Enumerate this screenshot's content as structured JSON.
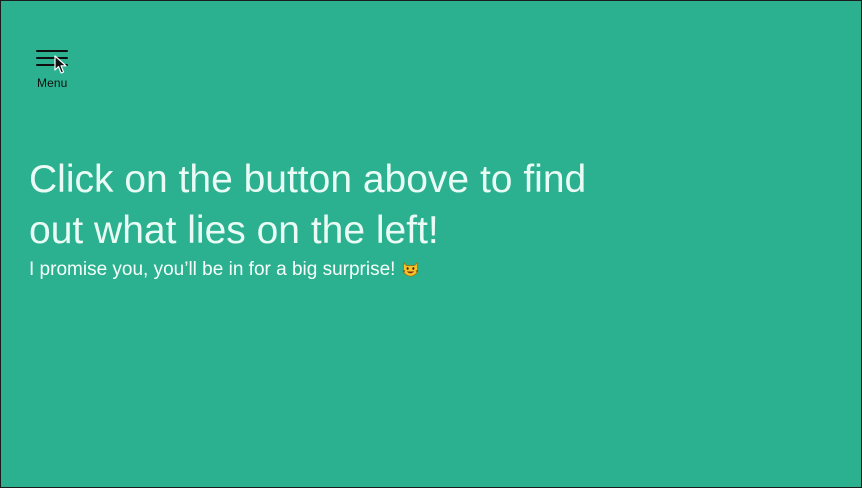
{
  "menu": {
    "label": "Menu",
    "icon": "hamburger-menu-icon"
  },
  "content": {
    "headline": "Click on the button above to find out what lies on the left!",
    "subline": "I promise you, you’ll be in for a big surprise!",
    "emoji_icon": "cat-face-emoji-icon"
  },
  "colors": {
    "background": "#2bb18f",
    "headline_text": "#e9fbf4",
    "menu_text": "#111111"
  }
}
